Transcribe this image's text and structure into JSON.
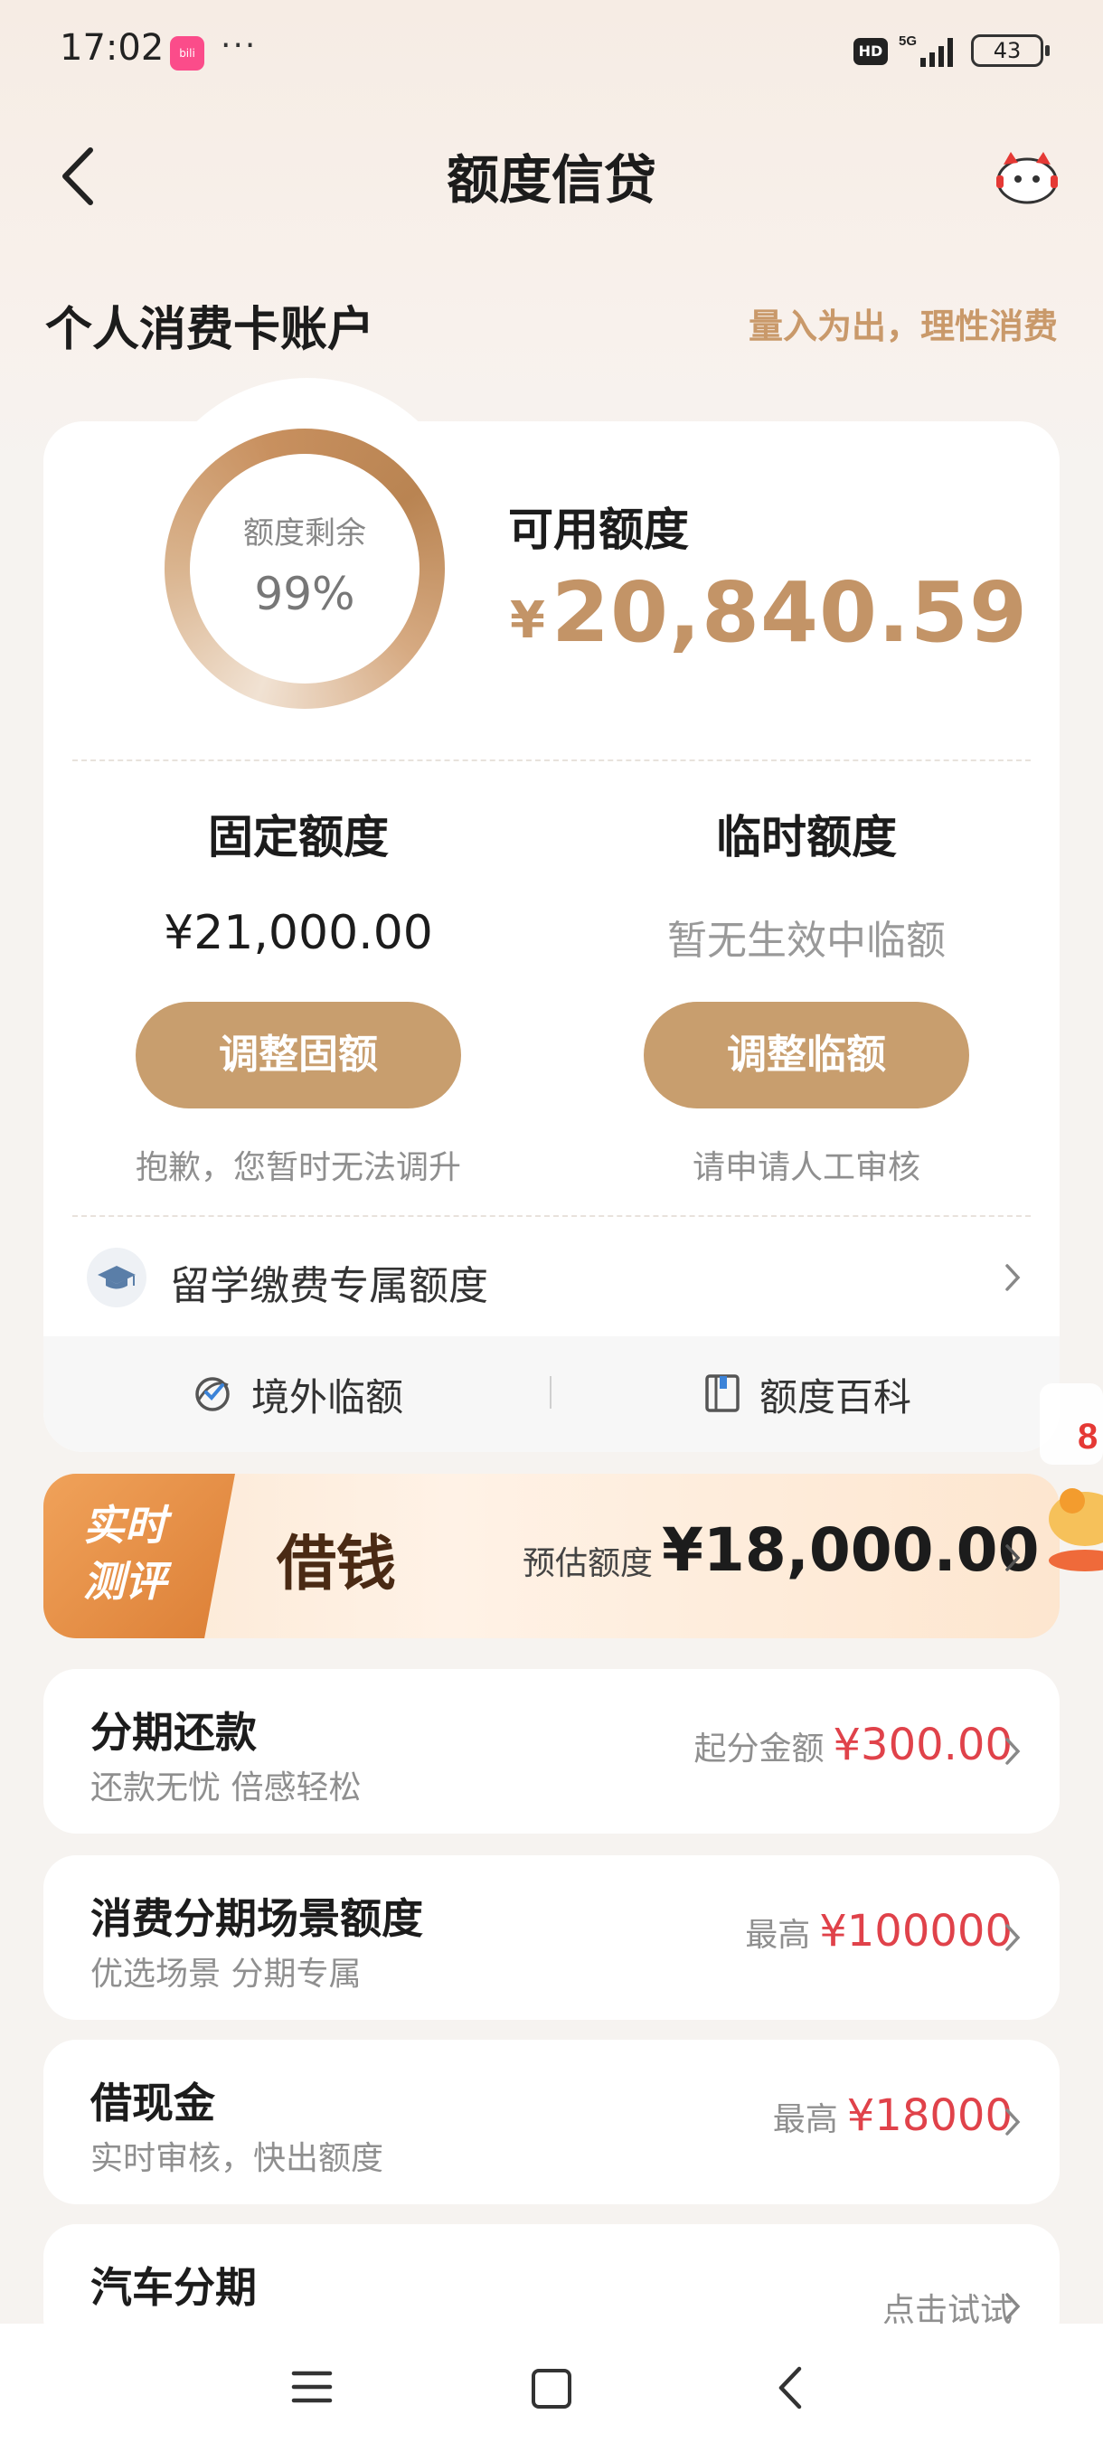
{
  "status_bar": {
    "time": "17:02",
    "dots": "···",
    "hd": "HD",
    "network": "5G",
    "battery": "43"
  },
  "header": {
    "title": "额度信贷"
  },
  "section": {
    "title": "个人消费卡账户",
    "slogan": "量入为出，理性消费"
  },
  "credit": {
    "ring_label": "额度剩余",
    "ring_value": "99%",
    "ring_fraction": 0.99,
    "available_label": "可用额度",
    "currency": "¥",
    "available_amount": "20,840.59",
    "fixed": {
      "title": "固定额度",
      "value": "¥21,000.00",
      "button": "调整固额",
      "note": "抱歉，您暂时无法调升"
    },
    "temporary": {
      "title": "临时额度",
      "value": "暂无生效中临额",
      "button": "调整临额",
      "note": "请申请人工审核"
    },
    "study_label": "留学缴费专属额度",
    "footer": {
      "overseas": "境外临额",
      "encyclopedia": "额度百科"
    }
  },
  "loan_banner": {
    "badge": "实时测评",
    "title": "借钱",
    "estimate_label": "预估额度",
    "estimate_value": "¥18,000.00"
  },
  "list": [
    {
      "title": "分期还款",
      "subtitle": "还款无忧 倍感轻松",
      "right_label": "起分金额",
      "right_value": "¥300.00"
    },
    {
      "title": "消费分期场景额度",
      "subtitle": "优选场景 分期专属",
      "right_label": "最高",
      "right_value": "¥100000"
    },
    {
      "title": "借现金",
      "subtitle": "实时审核，快出额度",
      "right_label": "最高",
      "right_value": "¥18000"
    },
    {
      "title": "汽车分期",
      "subtitle": "",
      "right_label": "",
      "right_value": "点击试试"
    }
  ],
  "colors": {
    "accent_gold": "#c89e6e",
    "amount_red": "#e0424a",
    "badge_orange": "#e38a3d"
  }
}
